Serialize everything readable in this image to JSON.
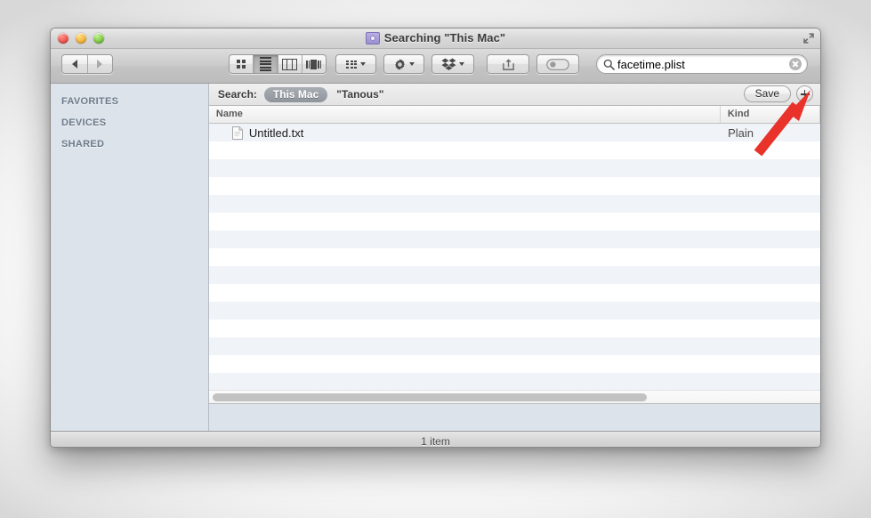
{
  "window": {
    "title": "Searching \"This Mac\"",
    "title_icon": "smart-folder-icon",
    "traffic_lights": [
      "close-button",
      "minimize-button",
      "zoom-button"
    ],
    "fullscreen_icon": "fullscreen-arrows-icon"
  },
  "toolbar": {
    "back_icon": "back-arrow-icon",
    "forward_icon": "forward-arrow-icon",
    "views": [
      {
        "name": "icon-view",
        "icon": "grid-icon",
        "active": false
      },
      {
        "name": "list-view",
        "icon": "lines-icon",
        "active": true
      },
      {
        "name": "column-view",
        "icon": "columns-icon",
        "active": false
      },
      {
        "name": "coverflow-view",
        "icon": "coverflow-icon",
        "active": false
      }
    ],
    "arrange_icon": "arrange-grid-icon",
    "action_icon": "gear-icon",
    "dropbox_icon": "dropbox-icon",
    "share_icon": "share-arrow-icon",
    "tag_icon": "tag-pill-icon"
  },
  "search": {
    "icon": "magnifier-icon",
    "value": "facetime.plist",
    "placeholder": "Search",
    "clear_icon": "clear-circle-icon"
  },
  "scope_bar": {
    "label": "Search:",
    "options": [
      {
        "label": "This Mac",
        "selected": true
      },
      {
        "label": "\"Tanous\"",
        "selected": false
      }
    ],
    "save_label": "Save",
    "add_icon": "plus-circle-icon"
  },
  "sidebar": {
    "sections": [
      {
        "label": "FAVORITES"
      },
      {
        "label": "DEVICES"
      },
      {
        "label": "SHARED"
      }
    ]
  },
  "file_list": {
    "columns": [
      {
        "label": "Name",
        "name": "column-name"
      },
      {
        "label": "Kind",
        "name": "column-kind"
      }
    ],
    "rows": [
      {
        "name": "Untitled.txt",
        "kind": "Plain",
        "icon": "text-document-icon"
      }
    ],
    "empty_row_count": 16
  },
  "scrollbar": {
    "orientation": "horizontal"
  },
  "status_bar": {
    "text": "1 item"
  },
  "annotation": {
    "type": "red-arrow",
    "color": "#e8322a",
    "points_to": "plus-circle-icon"
  }
}
